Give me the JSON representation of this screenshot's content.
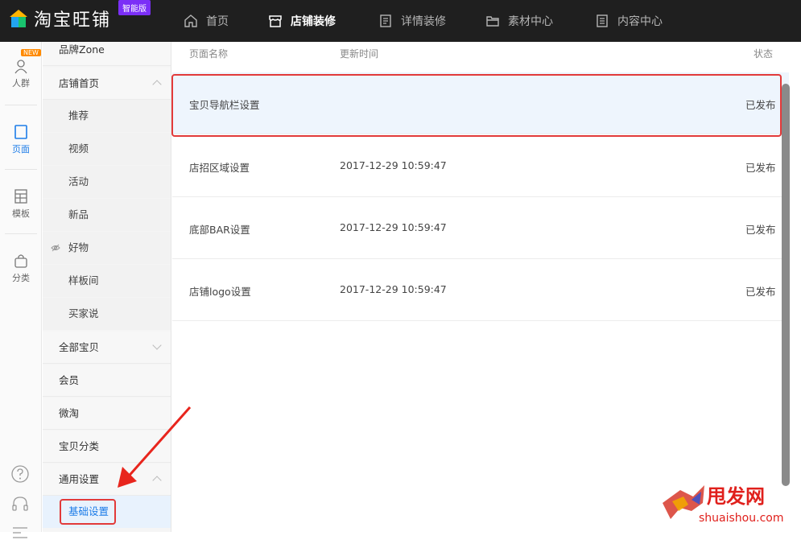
{
  "header": {
    "logo_text": "淘宝旺铺",
    "logo_badge": "智能版",
    "nav": [
      {
        "label": "首页",
        "icon": "home-icon"
      },
      {
        "label": "店铺装修",
        "icon": "store-icon"
      },
      {
        "label": "详情装修",
        "icon": "document-icon"
      },
      {
        "label": "素材中心",
        "icon": "folder-icon"
      },
      {
        "label": "内容中心",
        "icon": "list-icon"
      }
    ]
  },
  "rail": {
    "new_badge": "NEW",
    "items": [
      {
        "label": "人群",
        "icon": "user-icon"
      },
      {
        "label": "页面",
        "icon": "page-icon"
      },
      {
        "label": "模板",
        "icon": "template-icon"
      },
      {
        "label": "分类",
        "icon": "bag-icon"
      }
    ]
  },
  "sidebar": {
    "items": [
      {
        "label": "品牌Zone"
      },
      {
        "label": "店铺首页"
      },
      {
        "label": "推荐"
      },
      {
        "label": "视频"
      },
      {
        "label": "活动"
      },
      {
        "label": "新品"
      },
      {
        "label": "好物"
      },
      {
        "label": "样板间"
      },
      {
        "label": "买家说"
      },
      {
        "label": "全部宝贝"
      },
      {
        "label": "会员"
      },
      {
        "label": "微淘"
      },
      {
        "label": "宝贝分类"
      },
      {
        "label": "通用设置"
      },
      {
        "label": "基础设置"
      }
    ]
  },
  "table": {
    "columns": [
      "页面名称",
      "更新时间",
      "状态"
    ],
    "rows": [
      {
        "name": "宝贝导航栏设置",
        "time": "",
        "status": "已发布"
      },
      {
        "name": "店招区域设置",
        "time": "2017-12-29 10:59:47",
        "status": "已发布"
      },
      {
        "name": "底部BAR设置",
        "time": "2017-12-29 10:59:47",
        "status": "已发布"
      },
      {
        "name": "店铺logo设置",
        "time": "2017-12-29 10:59:47",
        "status": "已发布"
      }
    ]
  },
  "watermark": {
    "text": "甩发网",
    "url": "shuaishou.com"
  },
  "colors": {
    "accent": "#1c7ce8",
    "highlight": "#e23a3a",
    "topbar": "#1f1f1f"
  }
}
